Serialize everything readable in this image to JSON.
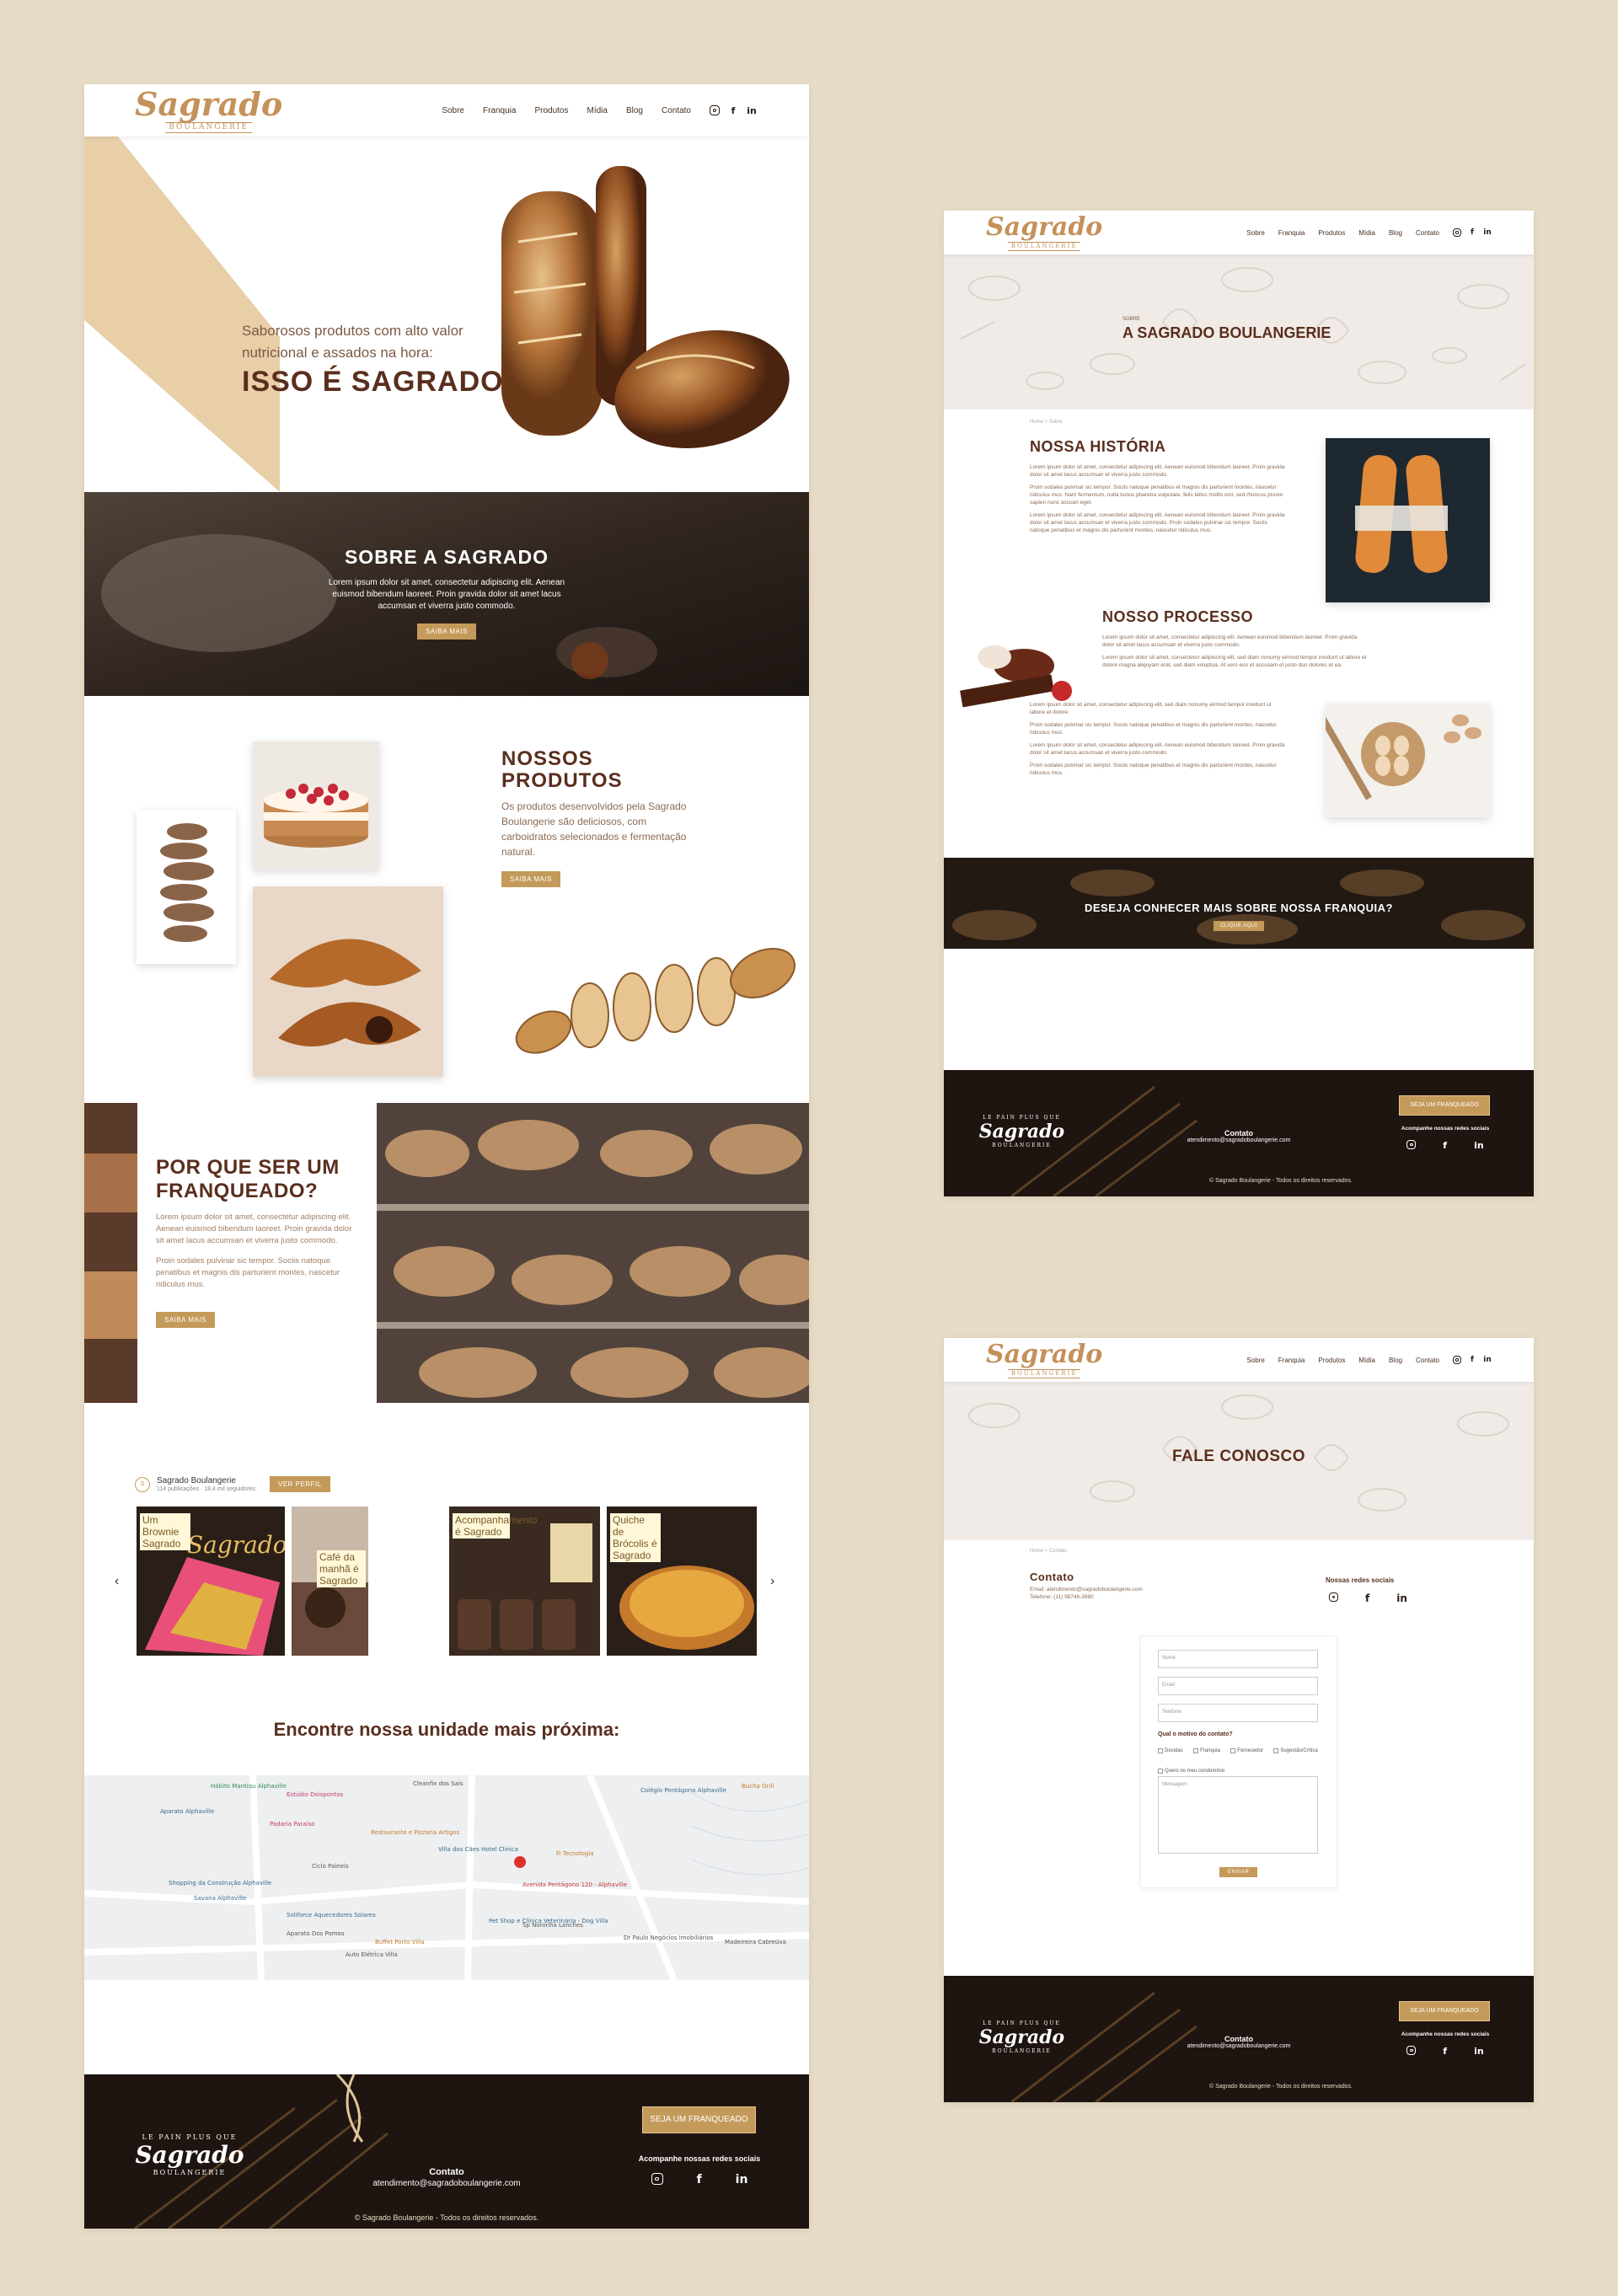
{
  "brand": {
    "script": "Sagrado",
    "sub": "BOULANGERIE",
    "emblem_top": "LE PAIN PLUS QUE",
    "emblem_bottom": "BOULANGERIE"
  },
  "nav": [
    "Sobre",
    "Franquia",
    "Produtos",
    "Mídia",
    "Blog",
    "Contato"
  ],
  "colors": {
    "accent": "#c49a5a",
    "brown": "#5a2e1e",
    "bg": "#e8dcc6",
    "dark": "#1e1410"
  },
  "home": {
    "hero": {
      "tagline": "Saborosos produtos com alto valor nutricional e assados na hora:",
      "title": "ISSO É SAGRADO"
    },
    "sobre": {
      "title": "SOBRE A SAGRADO",
      "text": "Lorem ipsum dolor sit amet, consectetur adipiscing elit. Aenean euismod bibendum laoreet. Proin gravida dolor sit amet lacus accumsan et viverra justo commodo.",
      "button": "SAIBA MAIS"
    },
    "produtos": {
      "title_1": "NOSSOS",
      "title_2": "PRODUTOS",
      "text": "Os produtos desenvolvidos pela Sagrado Boulangerie são deliciosos, com carboidratos selecionados e fermentação natural.",
      "button": "SAIBA MAIS"
    },
    "franquia": {
      "title": "POR QUE SER UM FRANQUEADO?",
      "text_1": "Lorem ipsum dolor sit amet, consectetur adipiscing elit. Aenean euismod bibendum laoreet. Proin gravida dolor sit amet lacus accumsan et viverra justo commodo.",
      "text_2": "Proin sodales pulvinar sic tempor. Sociis natoque penatibus et magnis dis parturient montes, nascetur ridiculus mus.",
      "button": "SAIBA MAIS"
    },
    "instagram": {
      "name": "Sagrado Boulangerie",
      "stats": "114 publicações · 18,4 mil seguidores",
      "button": "VER PERFIL",
      "captions": [
        "Um Brownie Sagrado",
        "Café da manhã é Sagrado",
        "Acompanhamento é Sagrado",
        "Quiche de Brócolis é Sagrado"
      ]
    },
    "find": "Encontre nossa unidade mais próxima:",
    "map_labels": [
      "Hábito Mantiqu Alphaville",
      "Shopping da Construção Alphaville",
      "Savana Alphaville",
      "Avenida Pentágono 120 - Alphaville",
      "Pet Shop e Clínica Veterinária - Dog Villa",
      "Buffet Porto Villa",
      "Colégio Pentágono Alphaville",
      "Cleanfix dos Sais",
      "Aparato Alphaville",
      "Soliforce Aquecedores Solares",
      "Ciclo Paineis",
      "Villa dos Cães Hotel Clínica",
      "Fi Tecnologia",
      "Sp Noronha Lanches",
      "Padaria Paraíso",
      "Dr Paulo Negócios Imobiliários",
      "Restaurante e Pizzaria Artigos",
      "Estúdio Doispontos",
      "Auto Elétrica Villa",
      "Aparato Dos Pomos",
      "Madeireira Cabreúva",
      "Bucha Grill"
    ]
  },
  "footer": {
    "button": "SEJA UM FRANQUEADO",
    "contact_label": "Contato",
    "email": "atendimento@sagradoboulangerie.com",
    "social_label": "Acompanhe nossas redes sociais",
    "copy": "© Sagrado Boulangerie - Todos os direitos reservados."
  },
  "about": {
    "pre": "SOBRE",
    "title": "A SAGRADO BOULANGERIE",
    "crumb": "Home > Sobre",
    "historia": {
      "title": "NOSSA HISTÓRIA",
      "p1": "Lorem ipsum dolor sit amet, consectetur adipiscing elit. Aenean euismod bibendum laoreet. Proin gravida dolor sit amet lacus accumsan et viverra justo commodo.",
      "p2": "Proin sodales pulvinar sic tempor. Sociis natoque penatibus et magnis dis parturient montes, nascetur ridiculus mus. Nam fermentum, nulla luctus pharetra vulputate, felis tellus mollis orci, sed rhoncus pronin sapien nunc accuan eget.",
      "p3": "Lorem ipsum dolor sit amet, consectetur adipiscing elit. Aenean euismod bibendum laoreet. Proin gravida dolor sit amet lacus accumsan et viverra justo commodo. Proin sodales pulvinar sic tempor. Sociis natoque penatibus et magnis dis parturient montes, nascetur ridiculus mus."
    },
    "processo": {
      "title": "NOSSO PROCESSO",
      "p1": "Lorem ipsum dolor sit amet, consectetur adipiscing elit. Aenean euismod bibendum laoreet. Proin gravida dolor sit amet lacus accumsan et viverra justo commodo.",
      "p2": "Lorem ipsum dolor sit amet, consectetur adipiscing elit, sed diam nonumy eirmod tempor invidunt ut labore et dolore magna aliquyam erat, sed diam voluptua. At vero eos et accusam et justo duo dolores et ea.",
      "p3": "Lorem ipsum dolor sit amet, consectetur adipiscing elit, sed diam nonumy eirmod tempor invidunt ut labore et dolore.",
      "p4": "Proin sodales pulvinar sic tempor. Sociis natoque penatibus et magnis dis parturient montes, nascetur ridiculus mus.",
      "p5": "Lorem ipsum dolor sit amet, consectetur adipiscing elit. Aenean euismod bibendum laoreet. Proin gravida dolor sit amet lacus accumsan et viverra justo commodo.",
      "p6": "Proin sodales pulvinar sic tempor. Sociis natoque penatibus et magnis dis parturient montes, nascetur ridiculus mus."
    },
    "cta": {
      "title": "DESEJA CONHECER MAIS SOBRE NOSSA FRANQUIA?",
      "button": "CLIQUE AQUI"
    }
  },
  "contact": {
    "title": "FALE CONOSCO",
    "crumb": "Home > Contato",
    "label": "Contato",
    "email": "Email: atendimento@sagradoboulangerie.com",
    "phone": "Telefone: (11) 98746-3880",
    "social_label": "Nossas redes sociais",
    "form": {
      "nome": "Nome",
      "email": "Email",
      "telefone": "Telefone",
      "question": "Qual o motivo do contato?",
      "options": [
        "Dúvidas",
        "Franquia",
        "Fornecedor",
        "Sugestão/Crítica",
        "Quero no meu condomínio"
      ],
      "message": "Mensagem",
      "submit": "ENVIAR"
    }
  }
}
